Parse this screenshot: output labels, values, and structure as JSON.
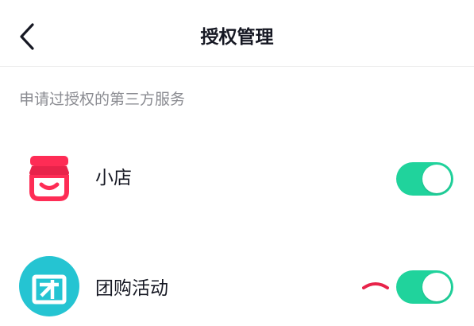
{
  "header": {
    "title": "授权管理",
    "back_icon": "chevron-left-icon"
  },
  "section": {
    "title": "申请过授权的第三方服务"
  },
  "services": [
    {
      "label": "小店",
      "icon": "shop-icon",
      "icon_color": "#fe2c55",
      "enabled": true
    },
    {
      "label": "团购活动",
      "icon": "group-buy-icon",
      "icon_color": "#25c4d2",
      "enabled": true
    }
  ],
  "colors": {
    "toggle_on": "#20d39c",
    "secondary_text": "#8a8b91",
    "primary_text": "#161823"
  }
}
